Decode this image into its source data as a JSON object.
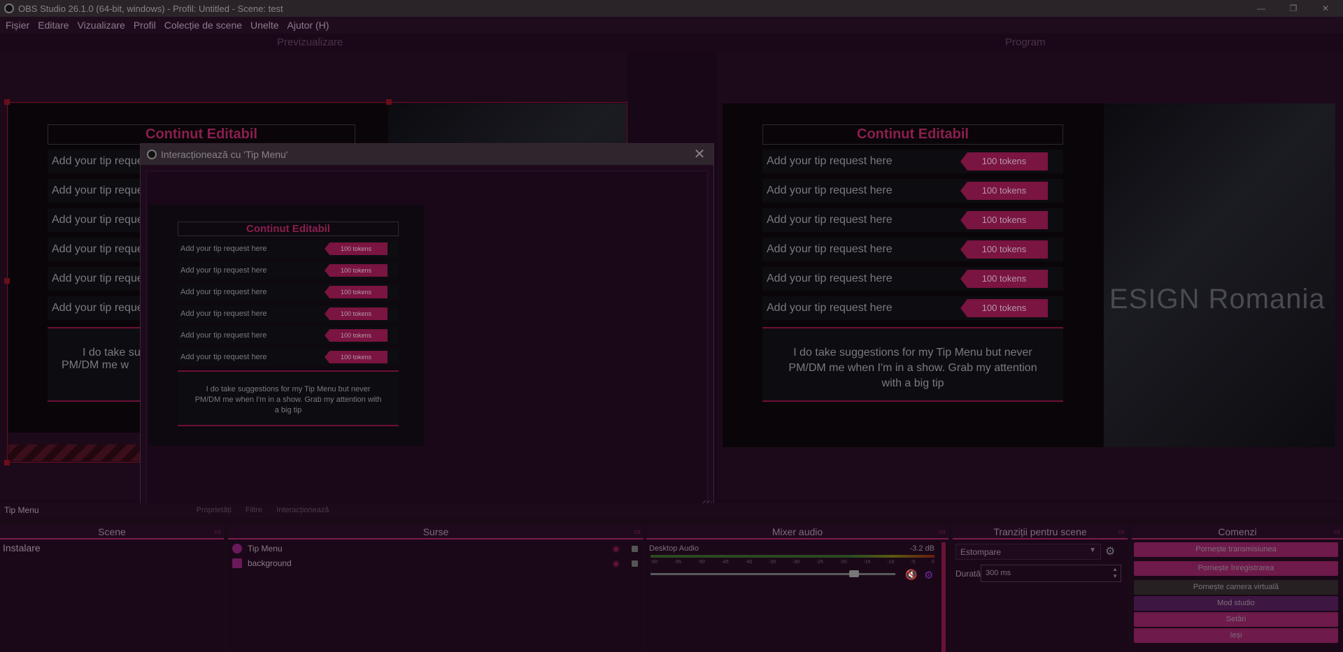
{
  "window": {
    "title": "OBS Studio 26.1.0 (64-bit, windows) - Profil: Untitled - Scene: test"
  },
  "menu": [
    "Fișier",
    "Editare",
    "Vizualizare",
    "Profil",
    "Colecție de scene",
    "Unelte",
    "Ajutor (H)"
  ],
  "preview": {
    "label": "Previzualizare"
  },
  "program": {
    "label": "Program"
  },
  "tip_menu": {
    "title": "Continut Editabil",
    "rows": [
      {
        "text": "Add your tip request here",
        "price": "100 tokens"
      },
      {
        "text": "Add your tip request here",
        "price": "100 tokens"
      },
      {
        "text": "Add your tip request here",
        "price": "100 tokens"
      },
      {
        "text": "Add your tip request here",
        "price": "100 tokens"
      },
      {
        "text": "Add your tip request here",
        "price": "100 tokens"
      },
      {
        "text": "Add your tip request here",
        "price": "100 tokens"
      }
    ],
    "preview_cut_row": "Add your tip reque",
    "note": "I do take suggestions for my Tip Menu but never PM/DM me when I'm in a show. Grab my attention with a big tip",
    "preview_cut_note_1": "I do take sugge",
    "preview_cut_note_2": "PM/DM me w",
    "watermark": "ESIGN Romania"
  },
  "dialog": {
    "title": "Interacționează cu 'Tip Menu'"
  },
  "source_toolbar": {
    "selected_source": "Tip Menu",
    "properties": "Proprietăți",
    "filters": "Filtre",
    "interact": "Interacționează"
  },
  "docks": {
    "scenes": {
      "title": "Scene",
      "items": [
        "Instalare"
      ]
    },
    "sources": {
      "title": "Surse",
      "items": [
        {
          "name": "Tip Menu",
          "icon": "globe-icon"
        },
        {
          "name": "background",
          "icon": "image-icon"
        }
      ]
    },
    "mixer": {
      "title": "Mixer audio",
      "channel": "Desktop Audio",
      "db": "-3.2 dB",
      "ticks": [
        "-60",
        "-55",
        "-50",
        "-45",
        "-40",
        "-35",
        "-30",
        "-25",
        "-20",
        "-15",
        "-10",
        "-5",
        "0"
      ],
      "volume_level": 0.85
    },
    "transitions": {
      "title": "Tranziții pentru scene",
      "selected": "Estompare",
      "duration_label": "Durată",
      "duration_value": "300 ms"
    },
    "controls": {
      "title": "Comenzi",
      "buttons": [
        "Pornește transmisiunea",
        "Pornește înregistrarea",
        "Pornește camera virtuală",
        "Mod studio",
        "Setări",
        "Ieși"
      ]
    }
  },
  "colors": {
    "accent": "#7a1c4a",
    "button": "#6e1a4a",
    "badge": "#7a1440"
  }
}
